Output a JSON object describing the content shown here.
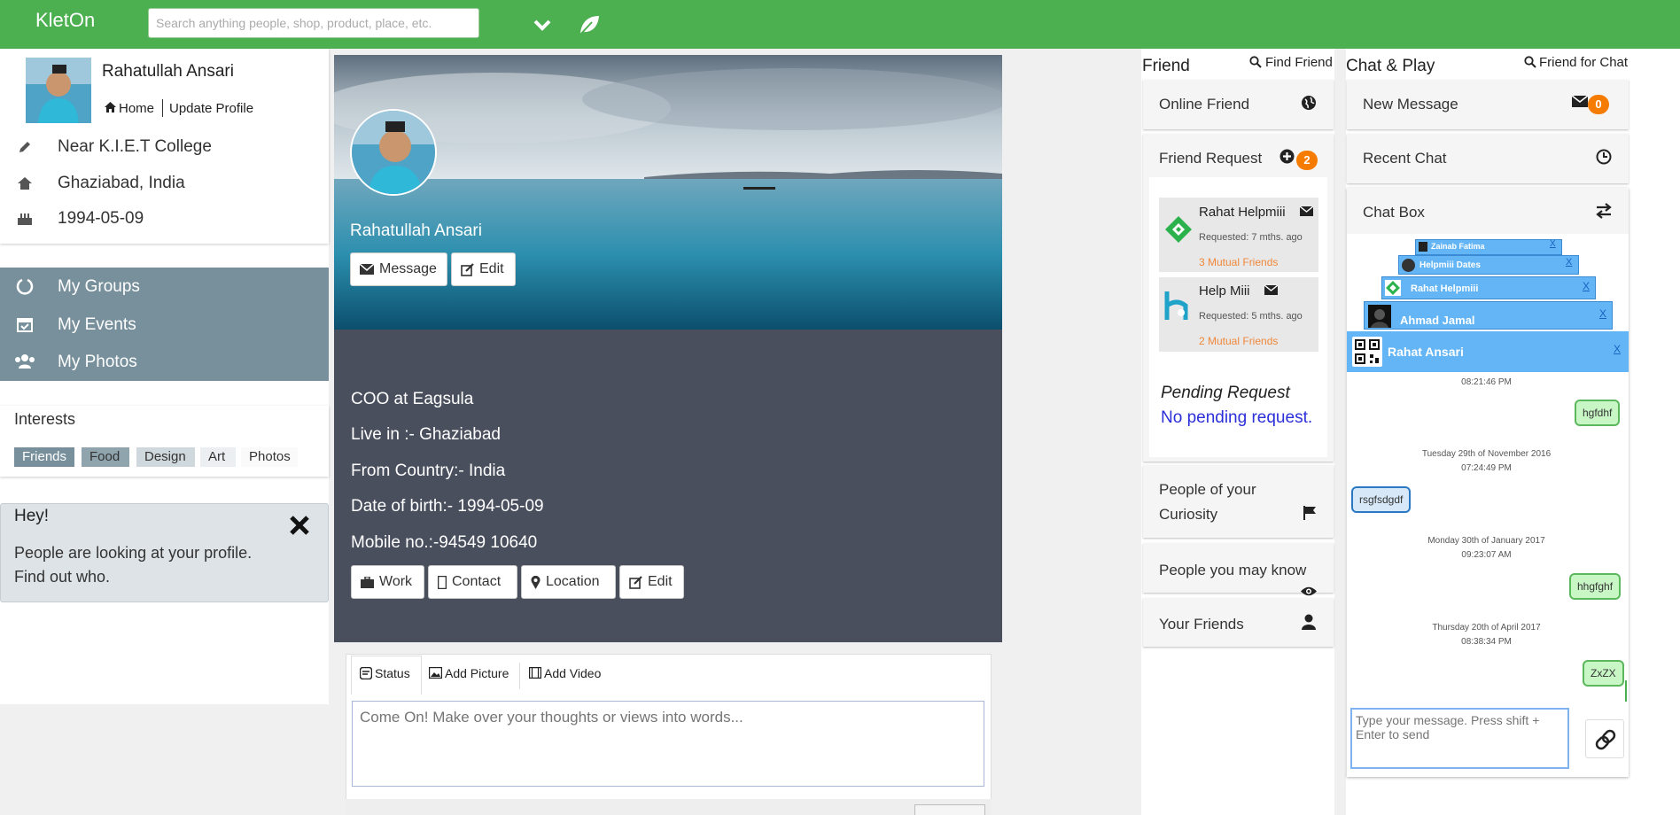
{
  "header": {
    "logo": "KletOn",
    "search_placeholder": "Search anything people, shop, product, place, etc."
  },
  "profile": {
    "name": "Rahatullah Ansari",
    "home_link": "Home",
    "update_link": "Update Profile",
    "details": [
      "Near K.I.E.T College",
      "Ghaziabad, India",
      "1994-05-09"
    ]
  },
  "groups_menu": [
    "My Groups",
    "My Events",
    "My Photos"
  ],
  "interests": {
    "title": "Interests",
    "tags": [
      "Friends",
      "Food",
      "Design",
      "Art",
      "Photos"
    ]
  },
  "notice": {
    "title": "Hey!",
    "line1": "People are looking at your profile.",
    "line2": "Find out who."
  },
  "cover": {
    "name": "Rahatullah Ansari",
    "message_button": "Message",
    "edit_button": "Edit"
  },
  "about": {
    "lines": [
      "COO at Eagsula",
      "Live in :- Ghaziabad",
      "From Country:- India",
      "Date of birth:- 1994-05-09",
      "Mobile no.:-94549 10640"
    ],
    "buttons": [
      "Work",
      "Contact",
      "Location",
      "Edit"
    ]
  },
  "composer": {
    "tabs": [
      "Status",
      "Add Picture",
      "Add Video"
    ],
    "placeholder": "Come On! Make over your thoughts or views into words..."
  },
  "friend_panel": {
    "title": "Friend",
    "find_link": "Find Friend",
    "online": "Online Friend",
    "requests_label": "Friend Request",
    "requests_count": "2",
    "requests": [
      {
        "name": "Rahat Helpmiii",
        "time": "Requested: 7 mths. ago",
        "mutual": "3 Mutual Friends"
      },
      {
        "name": "Help Miii",
        "time": "Requested: 5 mths. ago",
        "mutual": "2 Mutual Friends"
      }
    ],
    "pending_title": "Pending Request",
    "pending_text": "No pending request.",
    "curiosity_line1": "People of your",
    "curiosity_line2": "Curiosity",
    "may_know": "People you may know",
    "your_friends": "Your Friends"
  },
  "chat_panel": {
    "title": "Chat & Play",
    "find_link": "Friend for Chat",
    "new_message": "New Message",
    "new_message_count": "0",
    "recent_chat": "Recent Chat",
    "chat_box": "Chat Box",
    "tabs": [
      "Zainab Fatima",
      "Helpmiii Dates",
      "Rahat Helpmiii",
      "Ahmad Jamal"
    ],
    "active_chat": "Rahat Ansari",
    "close_label": "X",
    "messages": [
      {
        "ts1": "08:21:46 PM",
        "ts2": "",
        "text": "hgfdhf",
        "side": "me"
      },
      {
        "ts1": "Tuesday 29th of November 2016",
        "ts2": "07:24:49 PM",
        "text": "rsgfsdgdf",
        "side": "you"
      },
      {
        "ts1": "Monday 30th of January 2017",
        "ts2": "09:23:07 AM",
        "text": "hhgfghf",
        "side": "me"
      },
      {
        "ts1": "Thursday 20th of April 2017",
        "ts2": "08:38:34 PM",
        "text": "ZxZX",
        "side": "me"
      }
    ],
    "input_placeholder": "Type your message. Press shift + Enter to send"
  },
  "colors": {
    "topbar": "#4caf50",
    "menu": "#78909c",
    "about_bg": "#4a4f5e",
    "badge": "#f57c00",
    "chat_header": "#64b5f6"
  }
}
